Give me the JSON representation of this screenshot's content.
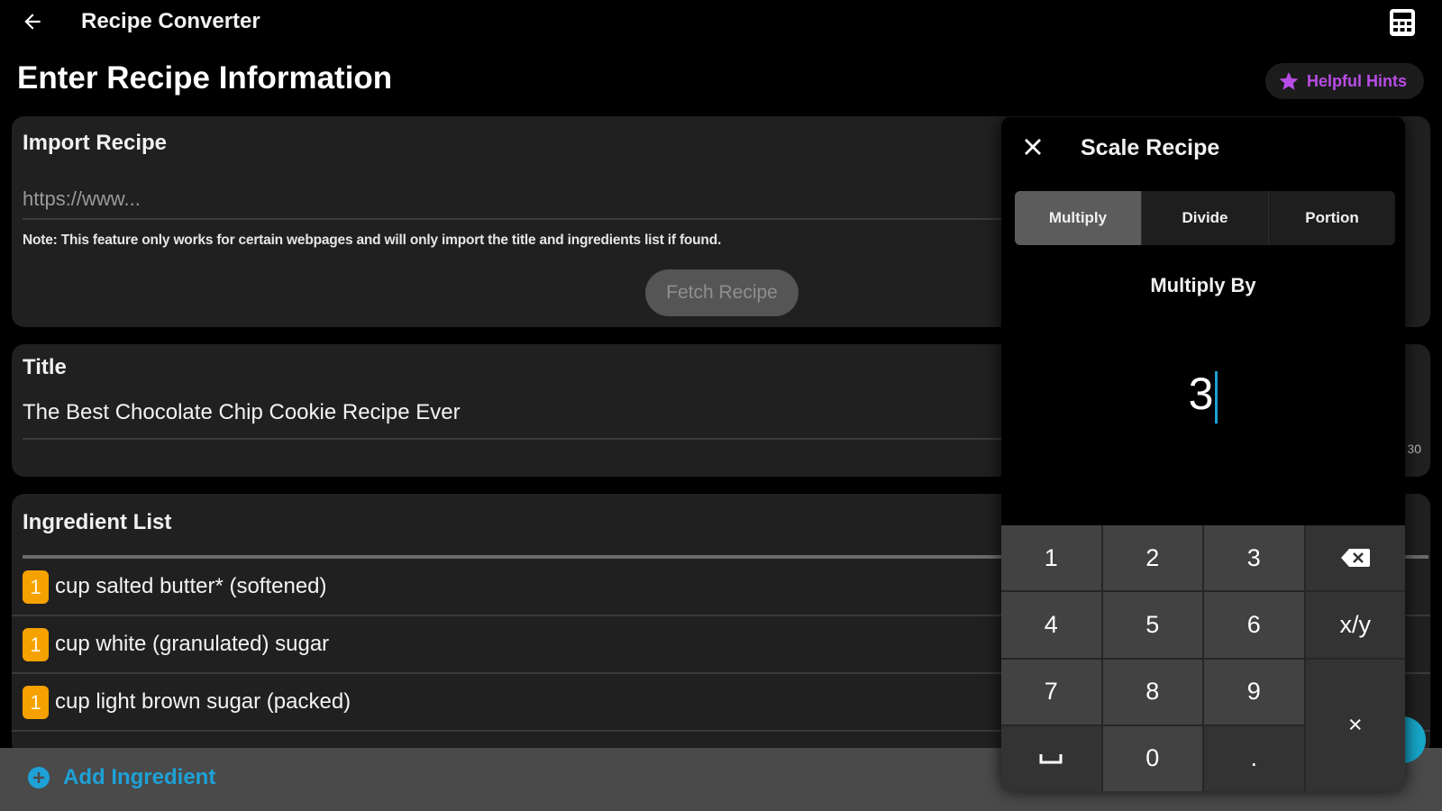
{
  "appbar": {
    "title": "Recipe Converter"
  },
  "page": {
    "heading": "Enter Recipe Information",
    "hints_label": "Helpful Hints"
  },
  "import": {
    "heading": "Import Recipe",
    "url_placeholder": "https://www...",
    "note": "Note: This feature only works for certain webpages and will only import the title and ingredients list if found.",
    "fetch_label": "Fetch Recipe"
  },
  "title_card": {
    "heading": "Title",
    "value": "The Best Chocolate Chip Cookie Recipe Ever",
    "counter_fragment": "30"
  },
  "ingredients": {
    "heading": "Ingredient List",
    "items": [
      {
        "qty": "1",
        "text": "cup salted butter* (softened)"
      },
      {
        "qty": "1",
        "text": "cup white (granulated) sugar"
      },
      {
        "qty": "1",
        "text": "cup light brown sugar (packed)"
      }
    ],
    "add_label": "Add Ingredient"
  },
  "dialog": {
    "title": "Scale Recipe",
    "tabs": [
      "Multiply",
      "Divide",
      "Portion"
    ],
    "active_tab": "Multiply",
    "multiply_label": "Multiply By",
    "value": "3",
    "keys": [
      "1",
      "2",
      "3",
      "4",
      "5",
      "6",
      "x/y",
      "7",
      "8",
      "9",
      "×",
      "0",
      "."
    ]
  },
  "colors": {
    "accent": "#1ea1d6",
    "hint": "#b84de6",
    "badge": "#f5a100"
  }
}
